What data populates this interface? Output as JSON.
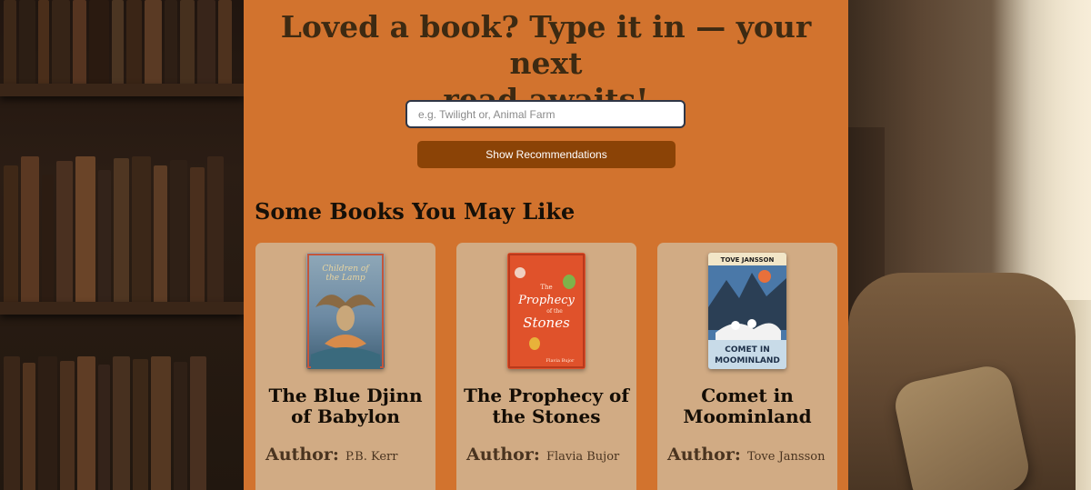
{
  "hero": {
    "headline_line1": "Loved a book? Type it in — your next",
    "headline_line2": "read awaits!"
  },
  "search": {
    "placeholder": "e.g. Twilight or, Animal Farm",
    "value": ""
  },
  "recommend_button": {
    "label": "Show Recommendations"
  },
  "results": {
    "heading": "Some Books You May Like",
    "author_label": "Author:",
    "books": [
      {
        "title": "The Blue Djinn of Babylon",
        "author": "P.B. Kerr",
        "cover_text": [
          "Children of",
          "the Lamp"
        ],
        "cover_color": "#6d8aa3"
      },
      {
        "title": "The Prophecy of the Stones",
        "author": "Flavia Bujor",
        "cover_text": [
          "The",
          "Prophecy",
          "of the",
          "Stones",
          "Flavia Bujor"
        ],
        "cover_color": "#e0522b"
      },
      {
        "title": "Comet in Moominland",
        "author": "Tove Jansson",
        "cover_text": [
          "TOVE JANSSON",
          "COMET IN",
          "MOOMINLAND"
        ],
        "cover_color": "#4a78a8"
      }
    ]
  },
  "colors": {
    "panel": "#d2732e",
    "button": "#8b4306",
    "card": "#d1ab84",
    "headline": "#3d2a12"
  }
}
